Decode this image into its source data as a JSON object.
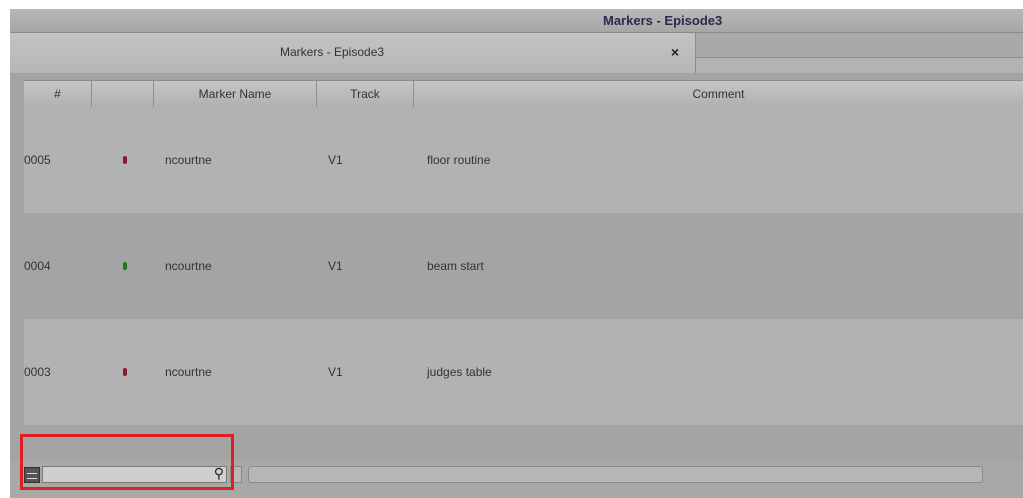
{
  "window": {
    "title": "Markers - Episode3"
  },
  "tab": {
    "label": "Markers - Episode3",
    "close_glyph": "×"
  },
  "table": {
    "headers": [
      "#",
      "",
      "Marker Name",
      "Track",
      "Comment"
    ],
    "rows": [
      {
        "num": "0005",
        "color": "#8b1a2a",
        "name": "ncourtne",
        "track": "V1",
        "comment": "floor routine"
      },
      {
        "num": "0004",
        "color": "#1f7a1f",
        "name": "ncourtne",
        "track": "V1",
        "comment": "beam start"
      },
      {
        "num": "0003",
        "color": "#8b1a2a",
        "name": "ncourtne",
        "track": "V1",
        "comment": "judges table"
      }
    ]
  },
  "search": {
    "value": "",
    "icon": "magnifier-icon"
  },
  "colors": {
    "highlight": "#e02020"
  }
}
